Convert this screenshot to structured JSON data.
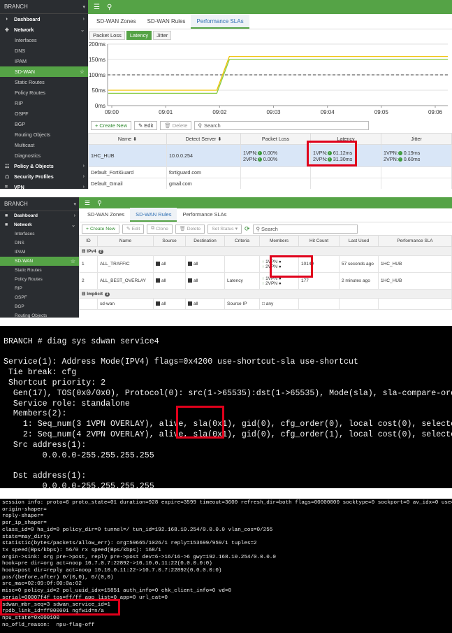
{
  "panel1": {
    "sidebar": {
      "brand": "BRANCH",
      "items": [
        {
          "label": "Dashboard",
          "kind": "group-collapsed",
          "icon": "dashboard-icon"
        },
        {
          "label": "Network",
          "kind": "group-open",
          "icon": "network-icon"
        },
        {
          "label": "Interfaces",
          "kind": "sub"
        },
        {
          "label": "DNS",
          "kind": "sub"
        },
        {
          "label": "IPAM",
          "kind": "sub"
        },
        {
          "label": "SD-WAN",
          "kind": "active"
        },
        {
          "label": "Static Routes",
          "kind": "sub"
        },
        {
          "label": "Policy Routes",
          "kind": "sub"
        },
        {
          "label": "RIP",
          "kind": "sub"
        },
        {
          "label": "OSPF",
          "kind": "sub"
        },
        {
          "label": "BGP",
          "kind": "sub"
        },
        {
          "label": "Routing Objects",
          "kind": "sub"
        },
        {
          "label": "Multicast",
          "kind": "sub"
        },
        {
          "label": "Diagnostics",
          "kind": "sub"
        },
        {
          "label": "Policy & Objects",
          "kind": "group-collapsed",
          "icon": "policy-icon"
        },
        {
          "label": "Security Profiles",
          "kind": "group-collapsed",
          "icon": "lock-icon"
        },
        {
          "label": "VPN",
          "kind": "group-collapsed",
          "icon": "vpn-icon"
        }
      ]
    },
    "tabs": [
      "SD-WAN Zones",
      "SD-WAN Rules",
      "Performance SLAs"
    ],
    "active_tab": 2,
    "subtabs": [
      "Packet Loss",
      "Latency",
      "Jitter"
    ],
    "active_subtab": 1,
    "chart_data": {
      "type": "line",
      "x": [
        "09:00",
        "09:01",
        "09:02",
        "09:03",
        "09:04",
        "09:05",
        "09:06"
      ],
      "yticks": [
        "200ms",
        "150ms",
        "100ms",
        "50ms",
        "0ms"
      ],
      "ylim": [
        0,
        200
      ],
      "threshold": 100,
      "series": [
        {
          "color": "#f0c000",
          "values": [
            50,
            50,
            50,
            160,
            160,
            160,
            160
          ]
        },
        {
          "color": "#88cc44",
          "values": [
            40,
            40,
            40,
            150,
            150,
            150,
            150
          ]
        }
      ]
    },
    "toolbar": {
      "create": "Create New",
      "edit": "Edit",
      "delete": "Delete",
      "search_placeholder": "Search"
    },
    "columns": [
      "Name",
      "Detect Server",
      "Packet Loss",
      "Latency",
      "Jitter"
    ],
    "rows": [
      {
        "name": "1HC_HUB",
        "server": "10.0.0.254",
        "loss1": "1VPN: 0.00%",
        "loss2": "2VPN: 0.00%",
        "lat1": "1VPN: 61.12ms",
        "lat2": "2VPN: 31.30ms",
        "jit1": "1VPN: 0.19ms",
        "jit2": "2VPN: 0.60ms"
      },
      {
        "name": "Default_FortiGuard",
        "server": "fortiguard.com"
      },
      {
        "name": "Default_Gmail",
        "server": "gmail.com"
      }
    ]
  },
  "panel2": {
    "sidebar": {
      "brand": "BRANCH",
      "items": [
        {
          "label": "Dashboard",
          "kind": "group-collapsed"
        },
        {
          "label": "Network",
          "kind": "group-open"
        },
        {
          "label": "Interfaces",
          "kind": "sub"
        },
        {
          "label": "DNS",
          "kind": "sub"
        },
        {
          "label": "IPAM",
          "kind": "sub"
        },
        {
          "label": "SD-WAN",
          "kind": "active"
        },
        {
          "label": "Static Routes",
          "kind": "sub"
        },
        {
          "label": "Policy Routes",
          "kind": "sub"
        },
        {
          "label": "RIP",
          "kind": "sub"
        },
        {
          "label": "OSPF",
          "kind": "sub"
        },
        {
          "label": "BGP",
          "kind": "sub"
        },
        {
          "label": "Routing Objects",
          "kind": "sub"
        }
      ]
    },
    "tabs": [
      "SD-WAN Zones",
      "SD-WAN Rules",
      "Performance SLAs"
    ],
    "active_tab": 1,
    "toolbar": {
      "create": "Create New",
      "edit": "Edit",
      "clone": "Clone",
      "delete": "Delete",
      "status": "Set Status",
      "search_placeholder": "Search"
    },
    "columns": [
      "ID",
      "Name",
      "Source",
      "Destination",
      "Criteria",
      "Members",
      "Hit Count",
      "Last Used",
      "Performance SLA"
    ],
    "group_ipv4": "IPv4",
    "group_ipv4_count": "2",
    "group_implicit": "Implicit",
    "group_implicit_count": "1",
    "rules": [
      {
        "id": "1",
        "name": "ALL_TRAFFIC",
        "src": "all",
        "dst": "all",
        "criteria": "",
        "m1": "1VPN",
        "m2": "2VPN",
        "hits": "10149",
        "last": "57 seconds ago",
        "sla": "1HC_HUB"
      },
      {
        "id": "2",
        "name": "ALL_BEST_OVERLAY",
        "src": "all",
        "dst": "all",
        "criteria": "Latency",
        "m1": "1VPN",
        "m2": "2VPN",
        "hits": "177",
        "last": "2 minutes ago",
        "sla": "1HC_HUB"
      },
      {
        "id": "",
        "name": "sd-wan",
        "src": "all",
        "dst": "all",
        "criteria": "Source IP",
        "m1": "any",
        "m2": "",
        "hits": "",
        "last": "",
        "sla": ""
      }
    ]
  },
  "terminal1": {
    "lines": [
      "",
      "BRANCH # diag sys sdwan service4",
      "",
      "Service(1): Address Mode(IPV4) flags=0x4200 use-shortcut-sla use-shortcut",
      " Tie break: cfg",
      " Shortcut priority: 2",
      "  Gen(17), TOS(0x0/0x0), Protocol(0): src(1->65535):dst(1->65535), Mode(sla), sla-compare-order",
      "  Service role: standalone",
      "  Members(2):",
      "    1: Seq_num(3 1VPN OVERLAY), alive, sla(0x1), gid(0), cfg_order(0), local cost(0), selected",
      "    2: Seq_num(4 2VPN OVERLAY), alive, sla(0x1), gid(0), cfg_order(1), local cost(0), selected",
      "  Src address(1):",
      "        0.0.0.0-255.255.255.255",
      "",
      "  Dst address(1):",
      "        0.0.0.0-255.255.255.255"
    ]
  },
  "terminal2": {
    "lines": [
      "session info: proto=6 proto_state=01 duration=928 expire=3599 timeout=3600 refresh_dir=both flags=00000000 socktype=0 sockport=0 av_idx=0 use=3",
      "origin-shaper=",
      "reply-shaper=",
      "per_ip_shaper=",
      "class_id=0 ha_id=0 policy_dir=0 tunnel=/ tun_id=192.168.10.254/0.0.0.0 vlan_cos=0/255",
      "state=may_dirty",
      "statistic(bytes/packets/allow_err): org=59665/1026/1 reply=153699/959/1 tuples=2",
      "tx speed(Bps/kbps): 56/0 rx speed(Bps/kbps): 168/1",
      "orgin->sink: org pre->post, reply pre->post dev=6->16/16->6 gwy=192.168.10.254/0.0.0.0",
      "hook=pre dir=org act=noop 10.7.0.7:22892->10.10.0.11:22(0.0.0.0:0)",
      "hook=post dir=reply act=noop 10.10.0.11:22->10.7.0.7:22892(0.0.0.0:0)",
      "pos/(before,after) 0/(0,0), 0/(0,0)",
      "src_mac=02:09:0f:00:0a:02",
      "misc=0 policy_id=2 pol_uuid_idx=15851 auth_info=0 chk_client_info=0 vd=0",
      "serial=00007f4f tos=ff/ff app_list=0 app=0 url_cat=0",
      "sdwan_mbr_seq=3 sdwan_service_id=1",
      "rpdb_link_id=ff000001 ngfwid=n/a",
      "npu_state=0x000100",
      "no_ofld_reason:  npu-flag-off"
    ]
  }
}
